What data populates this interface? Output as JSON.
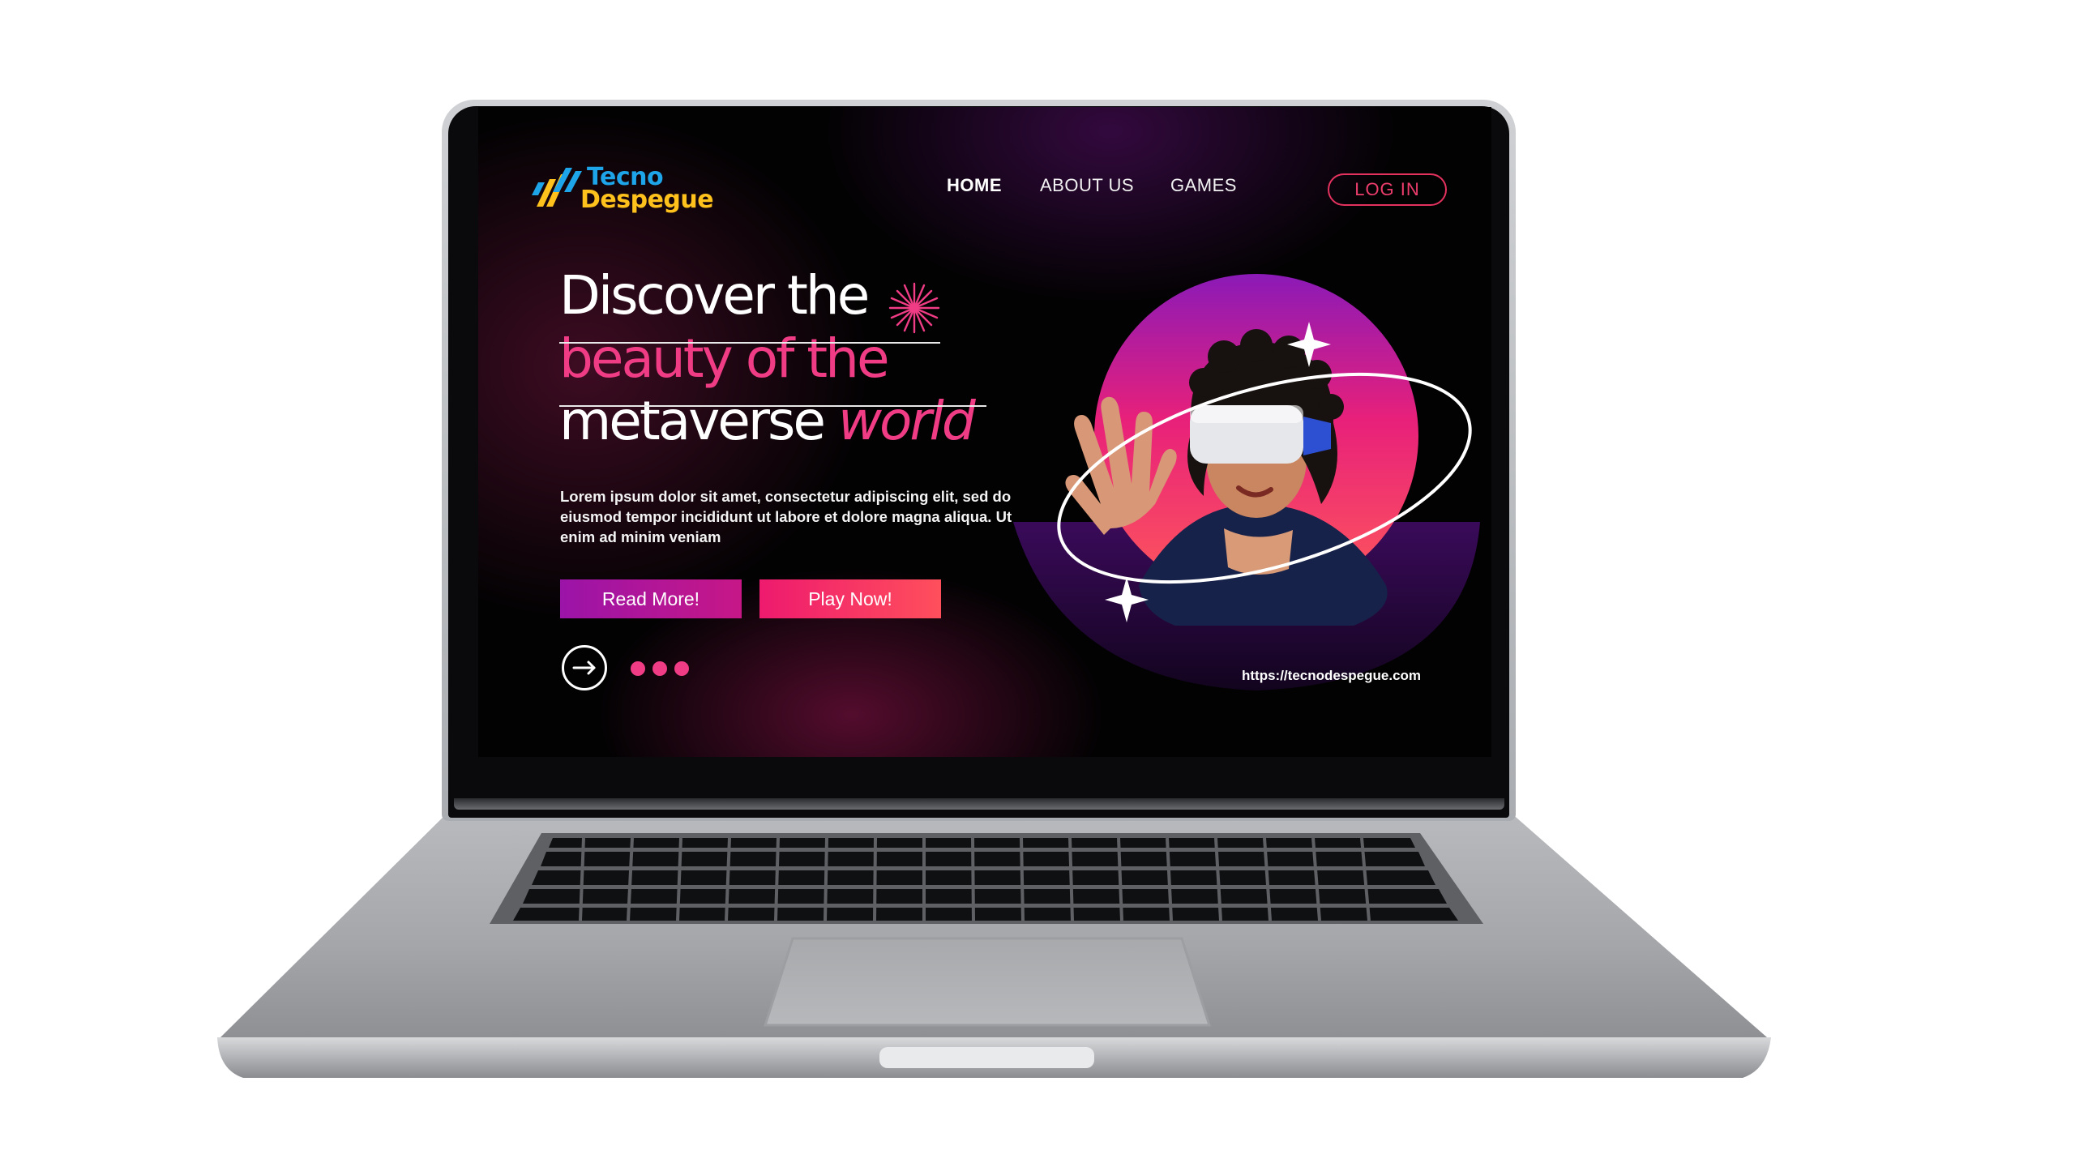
{
  "site": {
    "logo": {
      "line1": "Tecno",
      "line2": "Despegue"
    },
    "nav": [
      {
        "label": "HOME",
        "active": true
      },
      {
        "label": "ABOUT US",
        "active": false
      },
      {
        "label": "GAMES",
        "active": false
      }
    ],
    "login_label": "LOG IN",
    "hero": {
      "line1": "Discover the",
      "line2": "beauty of the",
      "line3_main": "metaverse",
      "line3_accent": "world",
      "paragraph": "Lorem ipsum dolor sit amet, consectetur adipiscing elit, sed do eiusmod tempor incididunt ut labore et dolore magna aliqua. Ut enim ad minim veniam",
      "read_more_label": "Read More!",
      "play_now_label": "Play Now!"
    },
    "url": "https://tecnodespegue.com"
  },
  "colors": {
    "accent_pink": "#ef3c84",
    "accent_purple": "#9b14a8",
    "logo_blue": "#1ea4e8",
    "logo_yellow": "#ffc21c",
    "background": "#030203"
  },
  "icons": {
    "logo": "lines-logo-icon",
    "sparkle": "sparkle-icon",
    "arrow": "arrow-right-circle-icon"
  }
}
